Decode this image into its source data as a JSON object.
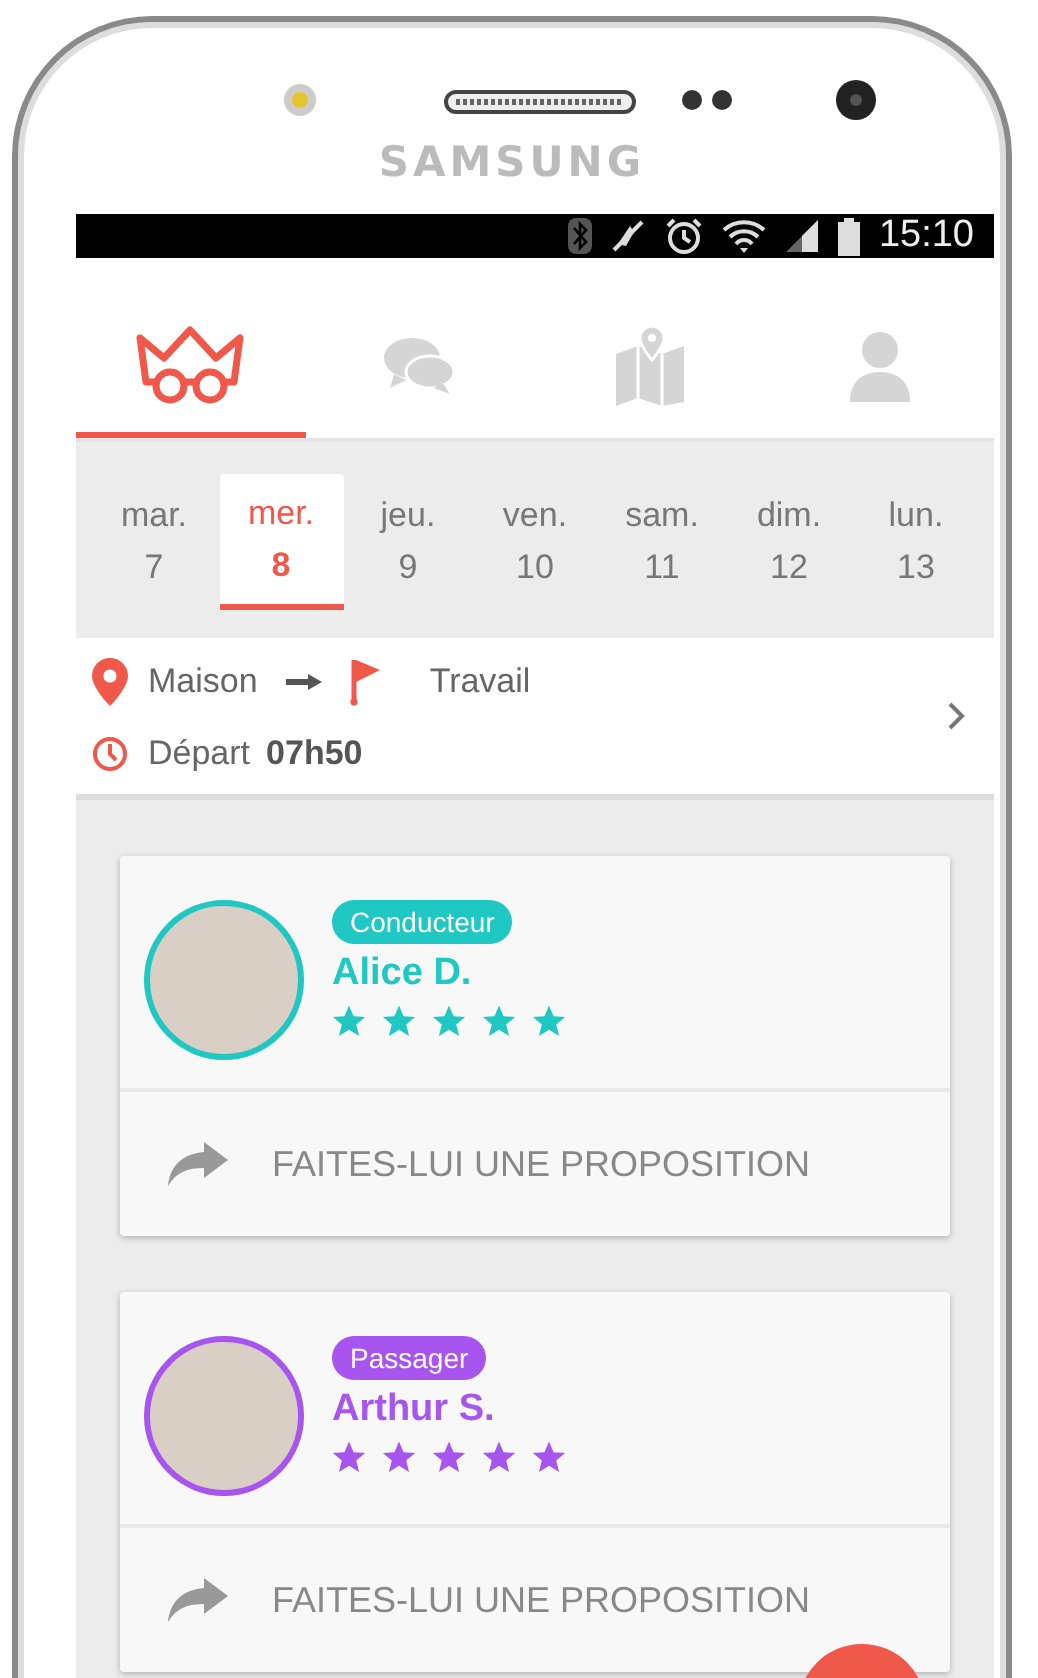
{
  "device": {
    "brand": "SAMSUNG"
  },
  "status_bar": {
    "time": "15:10"
  },
  "tabs": [
    {
      "selected": true
    },
    {
      "selected": false
    },
    {
      "selected": false
    },
    {
      "selected": false
    }
  ],
  "days": [
    {
      "day": "mar.",
      "date": "7",
      "selected": false
    },
    {
      "day": "mer.",
      "date": "8",
      "selected": true
    },
    {
      "day": "jeu.",
      "date": "9",
      "selected": false
    },
    {
      "day": "ven.",
      "date": "10",
      "selected": false
    },
    {
      "day": "sam.",
      "date": "11",
      "selected": false
    },
    {
      "day": "dim.",
      "date": "12",
      "selected": false
    },
    {
      "day": "lun.",
      "date": "13",
      "selected": false
    }
  ],
  "route": {
    "from": "Maison",
    "to": "Travail",
    "departure_label": "Départ",
    "departure_time": "07h50"
  },
  "cards": [
    {
      "role": "Conducteur",
      "name": "Alice D.",
      "stars": 5,
      "color": "#1fc8c2",
      "action": "FAITES-LUI UNE PROPOSITION"
    },
    {
      "role": "Passager",
      "name": "Arthur S.",
      "stars": 5,
      "color": "#a855f0",
      "action": "FAITES-LUI UNE PROPOSITION"
    }
  ]
}
